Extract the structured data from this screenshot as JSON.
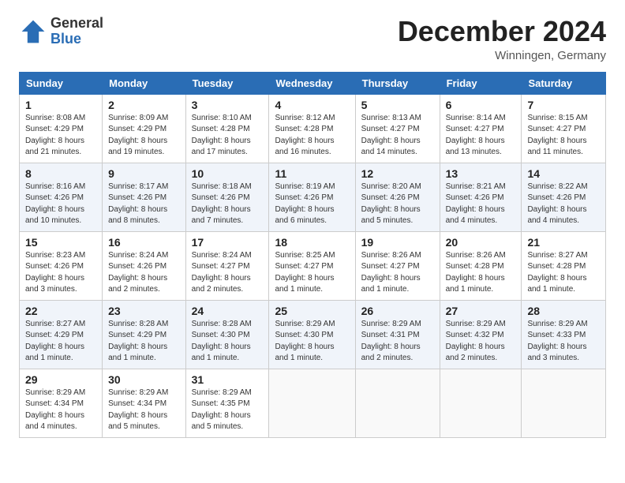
{
  "header": {
    "logo_general": "General",
    "logo_blue": "Blue",
    "month_title": "December 2024",
    "location": "Winningen, Germany"
  },
  "days_of_week": [
    "Sunday",
    "Monday",
    "Tuesday",
    "Wednesday",
    "Thursday",
    "Friday",
    "Saturday"
  ],
  "weeks": [
    [
      {
        "day": "1",
        "info": "Sunrise: 8:08 AM\nSunset: 4:29 PM\nDaylight: 8 hours and 21 minutes."
      },
      {
        "day": "2",
        "info": "Sunrise: 8:09 AM\nSunset: 4:29 PM\nDaylight: 8 hours and 19 minutes."
      },
      {
        "day": "3",
        "info": "Sunrise: 8:10 AM\nSunset: 4:28 PM\nDaylight: 8 hours and 17 minutes."
      },
      {
        "day": "4",
        "info": "Sunrise: 8:12 AM\nSunset: 4:28 PM\nDaylight: 8 hours and 16 minutes."
      },
      {
        "day": "5",
        "info": "Sunrise: 8:13 AM\nSunset: 4:27 PM\nDaylight: 8 hours and 14 minutes."
      },
      {
        "day": "6",
        "info": "Sunrise: 8:14 AM\nSunset: 4:27 PM\nDaylight: 8 hours and 13 minutes."
      },
      {
        "day": "7",
        "info": "Sunrise: 8:15 AM\nSunset: 4:27 PM\nDaylight: 8 hours and 11 minutes."
      }
    ],
    [
      {
        "day": "8",
        "info": "Sunrise: 8:16 AM\nSunset: 4:26 PM\nDaylight: 8 hours and 10 minutes."
      },
      {
        "day": "9",
        "info": "Sunrise: 8:17 AM\nSunset: 4:26 PM\nDaylight: 8 hours and 8 minutes."
      },
      {
        "day": "10",
        "info": "Sunrise: 8:18 AM\nSunset: 4:26 PM\nDaylight: 8 hours and 7 minutes."
      },
      {
        "day": "11",
        "info": "Sunrise: 8:19 AM\nSunset: 4:26 PM\nDaylight: 8 hours and 6 minutes."
      },
      {
        "day": "12",
        "info": "Sunrise: 8:20 AM\nSunset: 4:26 PM\nDaylight: 8 hours and 5 minutes."
      },
      {
        "day": "13",
        "info": "Sunrise: 8:21 AM\nSunset: 4:26 PM\nDaylight: 8 hours and 4 minutes."
      },
      {
        "day": "14",
        "info": "Sunrise: 8:22 AM\nSunset: 4:26 PM\nDaylight: 8 hours and 4 minutes."
      }
    ],
    [
      {
        "day": "15",
        "info": "Sunrise: 8:23 AM\nSunset: 4:26 PM\nDaylight: 8 hours and 3 minutes."
      },
      {
        "day": "16",
        "info": "Sunrise: 8:24 AM\nSunset: 4:26 PM\nDaylight: 8 hours and 2 minutes."
      },
      {
        "day": "17",
        "info": "Sunrise: 8:24 AM\nSunset: 4:27 PM\nDaylight: 8 hours and 2 minutes."
      },
      {
        "day": "18",
        "info": "Sunrise: 8:25 AM\nSunset: 4:27 PM\nDaylight: 8 hours and 1 minute."
      },
      {
        "day": "19",
        "info": "Sunrise: 8:26 AM\nSunset: 4:27 PM\nDaylight: 8 hours and 1 minute."
      },
      {
        "day": "20",
        "info": "Sunrise: 8:26 AM\nSunset: 4:28 PM\nDaylight: 8 hours and 1 minute."
      },
      {
        "day": "21",
        "info": "Sunrise: 8:27 AM\nSunset: 4:28 PM\nDaylight: 8 hours and 1 minute."
      }
    ],
    [
      {
        "day": "22",
        "info": "Sunrise: 8:27 AM\nSunset: 4:29 PM\nDaylight: 8 hours and 1 minute."
      },
      {
        "day": "23",
        "info": "Sunrise: 8:28 AM\nSunset: 4:29 PM\nDaylight: 8 hours and 1 minute."
      },
      {
        "day": "24",
        "info": "Sunrise: 8:28 AM\nSunset: 4:30 PM\nDaylight: 8 hours and 1 minute."
      },
      {
        "day": "25",
        "info": "Sunrise: 8:29 AM\nSunset: 4:30 PM\nDaylight: 8 hours and 1 minute."
      },
      {
        "day": "26",
        "info": "Sunrise: 8:29 AM\nSunset: 4:31 PM\nDaylight: 8 hours and 2 minutes."
      },
      {
        "day": "27",
        "info": "Sunrise: 8:29 AM\nSunset: 4:32 PM\nDaylight: 8 hours and 2 minutes."
      },
      {
        "day": "28",
        "info": "Sunrise: 8:29 AM\nSunset: 4:33 PM\nDaylight: 8 hours and 3 minutes."
      }
    ],
    [
      {
        "day": "29",
        "info": "Sunrise: 8:29 AM\nSunset: 4:34 PM\nDaylight: 8 hours and 4 minutes."
      },
      {
        "day": "30",
        "info": "Sunrise: 8:29 AM\nSunset: 4:34 PM\nDaylight: 8 hours and 5 minutes."
      },
      {
        "day": "31",
        "info": "Sunrise: 8:29 AM\nSunset: 4:35 PM\nDaylight: 8 hours and 5 minutes."
      },
      null,
      null,
      null,
      null
    ]
  ]
}
